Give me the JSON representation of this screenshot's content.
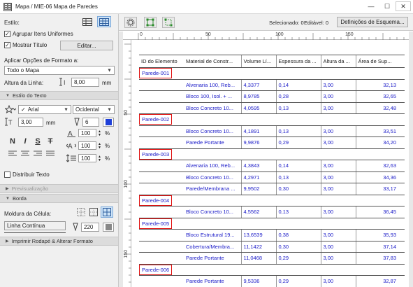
{
  "window": {
    "title": "Mapa / MIE-06 Mapa de Paredes",
    "minimize": "—",
    "maximize": "☐",
    "close": "✕"
  },
  "left_panel": {
    "style_label": "Estilo:",
    "group_uniform_label": "Agrupar Itens Uniformes",
    "group_uniform_checked": true,
    "show_title_label": "Mostrar Título",
    "show_title_checked": true,
    "edit_button": "Editar...",
    "apply_format_label": "Aplicar Opções de Formato a:",
    "apply_format_value": "Todo o Mapa",
    "row_height_label": "Altura da Linha:",
    "row_height_value": "8,00",
    "row_height_unit": "mm",
    "text_style_section": "Estilo do Texto",
    "font_value": "Arial",
    "encoding_value": "Ocidental",
    "font_size_value": "3,00",
    "font_size_unit": "mm",
    "pen_value": "6",
    "bold": "N",
    "italic": "I",
    "underline": "S",
    "strike": "T",
    "char_width_value": "100",
    "char_spacing_value": "100",
    "line_spacing_value": "100",
    "percent": "%",
    "distribute_label": "Distribuir Texto",
    "distribute_checked": false,
    "preview_section": "Previsualização",
    "border_section": "Borda",
    "cell_frame_label": "Moldura da Célula:",
    "line_type_value": "Linha Contínua",
    "line_pen_value": "220",
    "footer_section": "Imprimir Rodapé & Alterar Formato"
  },
  "toolbar": {
    "selected_label": "Selecionado: 0",
    "editable_label": "Editável: 0",
    "schema_button": "Definições de Esquema..."
  },
  "ruler": {
    "h_labels": [
      "0",
      "50",
      "100",
      "150"
    ],
    "v_labels": [
      "50",
      "100",
      "150"
    ]
  },
  "table": {
    "headers": [
      "ID do Elemento",
      "Material de Constr...",
      "Volume Lí...",
      "Espessura da ...",
      "Altura da ...",
      "Área de Sup..."
    ],
    "groups": [
      {
        "id": "Parede-001",
        "rows": [
          [
            "Alvenaria 100, Reb...",
            "4,3377",
            "0,14",
            "3,00",
            "32,13"
          ],
          [
            "Bloco 100, Isol. + ...",
            "8,9785",
            "0,28",
            "3,00",
            "32,65"
          ],
          [
            "Bloco Concreto 10...",
            "4,0595",
            "0,13",
            "3,00",
            "32,48"
          ]
        ]
      },
      {
        "id": "Parede-002",
        "rows": [
          [
            "Bloco Concreto 10...",
            "4,1891",
            "0,13",
            "3,00",
            "33,51"
          ],
          [
            "Parede Portante",
            "9,9876",
            "0,29",
            "3,00",
            "34,20"
          ]
        ]
      },
      {
        "id": "Parede-003",
        "rows": [
          [
            "Alvenaria 100, Reb...",
            "4,3843",
            "0,14",
            "3,00",
            "32,63"
          ],
          [
            "Bloco Concreto 10...",
            "4,2971",
            "0,13",
            "3,00",
            "34,36"
          ],
          [
            "Parede/Membrana ...",
            "9,9502",
            "0,30",
            "3,00",
            "33,17"
          ]
        ]
      },
      {
        "id": "Parede-004",
        "rows": [
          [
            "Bloco Concreto 10...",
            "4,5562",
            "0,13",
            "3,00",
            "36,45"
          ]
        ]
      },
      {
        "id": "Parede-005",
        "rows": [
          [
            "Bloco Estrutural 19...",
            "13,6539",
            "0,38",
            "3,00",
            "35,93"
          ],
          [
            "Cobertura/Membra...",
            "11,1422",
            "0,30",
            "3,00",
            "37,14"
          ],
          [
            "Parede Portante",
            "11,0468",
            "0,29",
            "3,00",
            "37,83"
          ]
        ]
      },
      {
        "id": "Parede-006",
        "rows": [
          [
            "Parede Portante",
            "9,5336",
            "0,29",
            "3,00",
            "32,87"
          ]
        ]
      }
    ]
  },
  "colors": {
    "value_text": "#1a1ac8",
    "highlight_box": "#e01010",
    "panel_bg": "#f0f0f0"
  }
}
